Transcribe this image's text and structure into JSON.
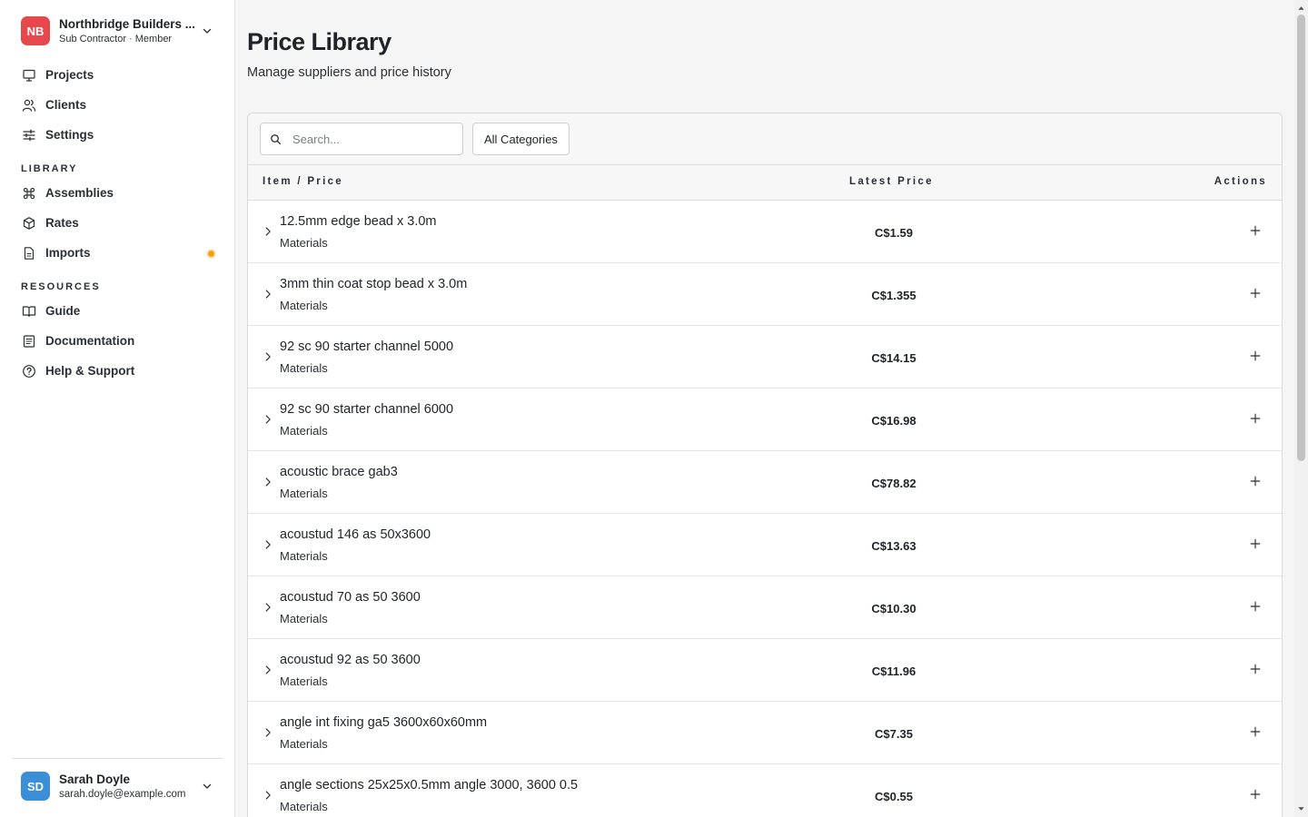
{
  "org": {
    "initials": "NB",
    "name": "Northbridge Builders ...",
    "subtitle": "Sub Contractor · Member",
    "avatar_color": "#e5484d"
  },
  "nav": {
    "main": [
      {
        "label": "Projects",
        "icon": "presentation-icon"
      },
      {
        "label": "Clients",
        "icon": "users-icon"
      },
      {
        "label": "Settings",
        "icon": "sliders-icon"
      }
    ],
    "library_label": "LIBRARY",
    "library": [
      {
        "label": "Assemblies",
        "icon": "command-icon"
      },
      {
        "label": "Rates",
        "icon": "cube-icon"
      },
      {
        "label": "Imports",
        "icon": "file-icon",
        "badge_color": "#f59e0b"
      }
    ],
    "resources_label": "RESOURCES",
    "resources": [
      {
        "label": "Guide",
        "icon": "book-open-icon"
      },
      {
        "label": "Documentation",
        "icon": "doc-lines-icon"
      },
      {
        "label": "Help & Support",
        "icon": "help-circle-icon"
      }
    ]
  },
  "user": {
    "initials": "SD",
    "name": "Sarah Doyle",
    "email": "sarah.doyle@example.com",
    "avatar_color": "#3b8fd6"
  },
  "page": {
    "title": "Price Library",
    "subtitle": "Manage suppliers and price history"
  },
  "toolbar": {
    "search_placeholder": "Search...",
    "category_button": "All Categories"
  },
  "table": {
    "headers": {
      "item": "Item / Price",
      "price": "Latest Price",
      "actions": "Actions"
    },
    "rows": [
      {
        "name": "12.5mm edge bead x 3.0m",
        "category": "Materials",
        "price": "C$1.59"
      },
      {
        "name": "3mm thin coat stop bead x 3.0m",
        "category": "Materials",
        "price": "C$1.355"
      },
      {
        "name": "92 sc 90 starter channel 5000",
        "category": "Materials",
        "price": "C$14.15"
      },
      {
        "name": "92 sc 90 starter channel 6000",
        "category": "Materials",
        "price": "C$16.98"
      },
      {
        "name": "acoustic brace gab3",
        "category": "Materials",
        "price": "C$78.82"
      },
      {
        "name": "acoustud 146 as 50x3600",
        "category": "Materials",
        "price": "C$13.63"
      },
      {
        "name": "acoustud 70 as 50 3600",
        "category": "Materials",
        "price": "C$10.30"
      },
      {
        "name": "acoustud 92 as 50 3600",
        "category": "Materials",
        "price": "C$11.96"
      },
      {
        "name": "angle int fixing ga5 3600x60x60mm",
        "category": "Materials",
        "price": "C$7.35"
      },
      {
        "name": "angle sections 25x25x0.5mm angle 3000, 3600 0.5",
        "category": "Materials",
        "price": "C$0.55"
      }
    ]
  }
}
